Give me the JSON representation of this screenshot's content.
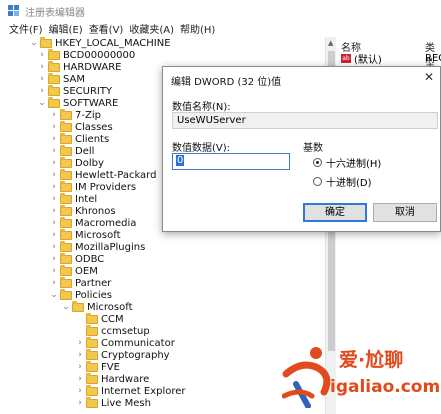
{
  "window": {
    "title": "注册表编辑器"
  },
  "menu": [
    {
      "label": "文件(F)"
    },
    {
      "label": "编辑(E)"
    },
    {
      "label": "查看(V)"
    },
    {
      "label": "收藏夹(A)"
    },
    {
      "label": "帮助(H)"
    }
  ],
  "tree": [
    {
      "label": "HKEY_LOCAL_MACHINE",
      "expanded": true
    },
    {
      "label": "BCD00000000",
      "expanded": false
    },
    {
      "label": "HARDWARE",
      "expanded": false
    },
    {
      "label": "SAM",
      "expanded": false
    },
    {
      "label": "SECURITY",
      "expanded": false
    },
    {
      "label": "SOFTWARE",
      "expanded": true
    },
    {
      "label": "7-Zip",
      "expanded": false
    },
    {
      "label": "Classes",
      "expanded": false
    },
    {
      "label": "Clients",
      "expanded": false
    },
    {
      "label": "Dell",
      "expanded": false
    },
    {
      "label": "Dolby",
      "expanded": false
    },
    {
      "label": "Hewlett-Packard",
      "expanded": false
    },
    {
      "label": "IM Providers",
      "expanded": false
    },
    {
      "label": "Intel",
      "expanded": false
    },
    {
      "label": "Khronos",
      "expanded": false
    },
    {
      "label": "Macromedia",
      "expanded": false
    },
    {
      "label": "Microsoft",
      "expanded": false
    },
    {
      "label": "MozillaPlugins",
      "expanded": false
    },
    {
      "label": "ODBC",
      "expanded": false
    },
    {
      "label": "OEM",
      "expanded": false
    },
    {
      "label": "Partner",
      "expanded": false
    },
    {
      "label": "Policies",
      "expanded": true
    },
    {
      "label": "Microsoft",
      "expanded": true
    },
    {
      "label": "CCM",
      "expanded": null
    },
    {
      "label": "ccmsetup",
      "expanded": null
    },
    {
      "label": "Communicator",
      "expanded": false
    },
    {
      "label": "Cryptography",
      "expanded": false
    },
    {
      "label": "FVE",
      "expanded": false
    },
    {
      "label": "Hardware",
      "expanded": false
    },
    {
      "label": "Internet Explorer",
      "expanded": false
    },
    {
      "label": "Live Mesh",
      "expanded": false
    }
  ],
  "values_pane": {
    "col_name": "名称",
    "col_type": "类型",
    "rows": [
      {
        "name": "(默认)",
        "type": "REG",
        "icon": "string-value-icon"
      }
    ]
  },
  "dialog": {
    "title": "编辑 DWORD (32 位)值",
    "value_name_label": "数值名称(N):",
    "value_name": "UseWUServer",
    "value_data_label": "数值数据(V):",
    "value_data": "0",
    "base_label": "基数",
    "hex_label": "十六进制(H)",
    "dec_label": "十进制(D)",
    "selected_base": "hex",
    "ok_label": "确定",
    "cancel_label": "取消"
  },
  "watermark": {
    "title": "爱·尬聊",
    "subtitle": "igaliao.com"
  },
  "colors": {
    "accent": "#2d7bd6",
    "folder": "#f2c84b",
    "watermark": "#e24a1e"
  }
}
